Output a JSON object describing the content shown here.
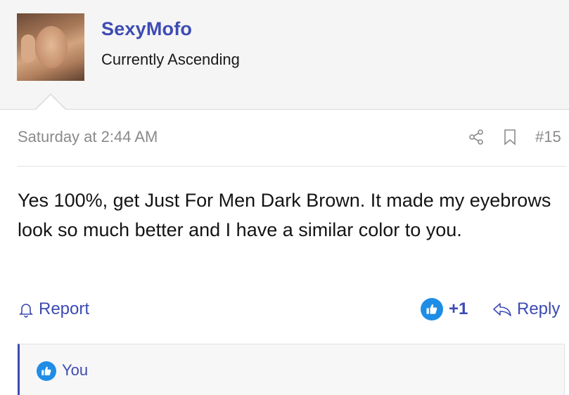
{
  "author": {
    "username": "SexyMofo",
    "title": "Currently Ascending"
  },
  "post": {
    "date": "Saturday at 2:44 AM",
    "number": "#15",
    "body": "Yes 100%, get Just For Men Dark Brown. It made my eyebrows look so much better and I have a similar color to you."
  },
  "actions": {
    "report_label": "Report",
    "like_count": "+1",
    "reply_label": "Reply"
  },
  "reactions": {
    "label": "You"
  },
  "icons": {
    "share": "share-icon",
    "bookmark": "bookmark-icon",
    "report": "bell-icon",
    "like": "thumbs-up-icon",
    "reply": "reply-arrow-icon"
  },
  "colors": {
    "link": "#3d4bb3",
    "like_badge": "#1f8de6",
    "muted": "#8a8a8a",
    "header_bg": "#f5f5f5"
  }
}
